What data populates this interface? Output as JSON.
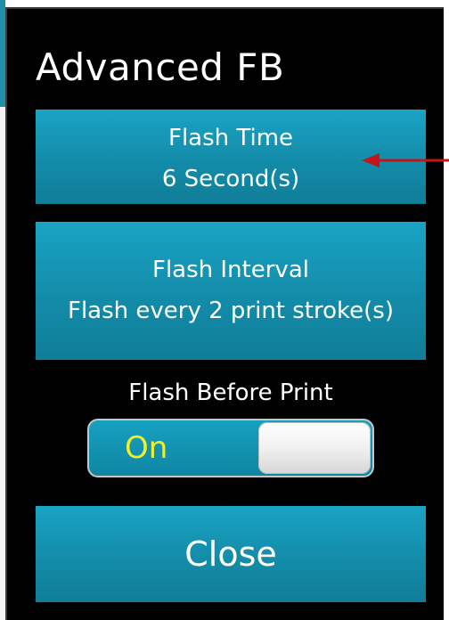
{
  "dialog": {
    "title": "Advanced FB"
  },
  "flash_time": {
    "label": "Flash Time",
    "value": "6 Second(s)"
  },
  "flash_interval": {
    "label": "Flash Interval",
    "value": "Flash every 2 print stroke(s)"
  },
  "flash_before_print": {
    "label": "Flash Before Print",
    "state": "On"
  },
  "close_button": {
    "label": "Close"
  },
  "colors": {
    "background": "#000000",
    "tile": "#138ca9",
    "toggle_text": "#f4ee27",
    "arrow": "#c0161c"
  },
  "annotation": {
    "icon": "arrow-left-icon"
  }
}
